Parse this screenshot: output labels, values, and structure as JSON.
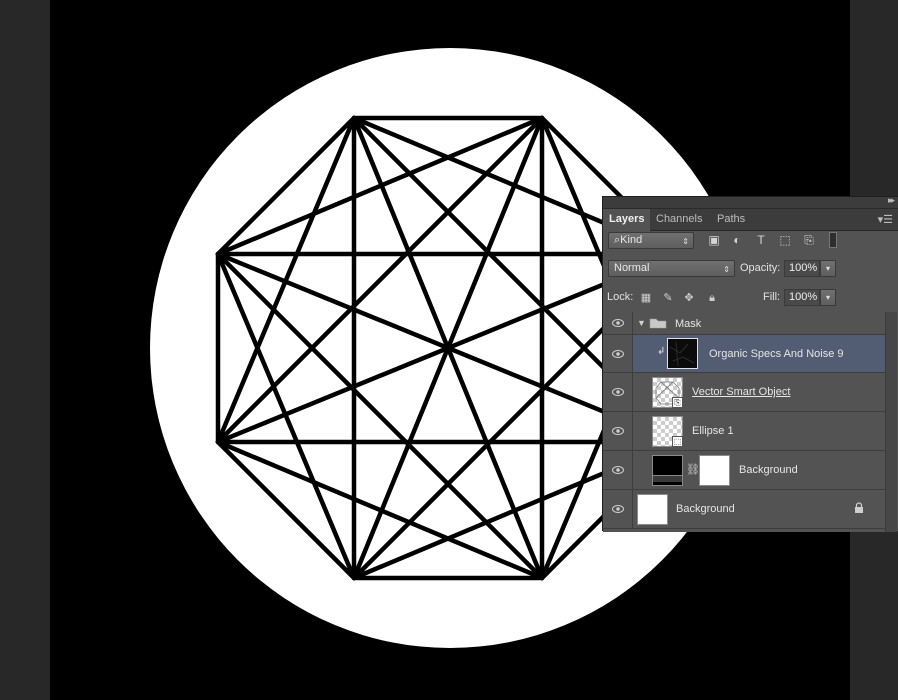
{
  "panel": {
    "tabs": [
      {
        "label": "Layers",
        "active": true
      },
      {
        "label": "Channels",
        "active": false
      },
      {
        "label": "Paths",
        "active": false
      }
    ],
    "filter": {
      "kind_label": "Kind",
      "icons": [
        "image-filter-icon",
        "adjustment-filter-icon",
        "type-filter-icon",
        "shape-filter-icon",
        "smart-object-filter-icon"
      ]
    },
    "blend_mode": "Normal",
    "opacity_label": "Opacity:",
    "opacity_value": "100%",
    "lock_label": "Lock:",
    "lock_icons": [
      "lock-transparent-icon",
      "lock-image-icon",
      "lock-position-icon",
      "lock-all-icon"
    ],
    "fill_label": "Fill:",
    "fill_value": "100%",
    "layers": [
      {
        "name": "Mask",
        "type": "group",
        "expanded": true,
        "visible": true
      },
      {
        "name": "Organic Specs And Noise 9",
        "type": "clipped",
        "selected": true,
        "visible": true
      },
      {
        "name": "Vector Smart Object",
        "type": "smart-object",
        "visible": true
      },
      {
        "name": "Ellipse 1",
        "type": "shape",
        "visible": true
      },
      {
        "name": "Background",
        "type": "masked",
        "visible": true
      },
      {
        "name": "Background",
        "type": "background",
        "locked": true,
        "visible": true
      }
    ]
  },
  "colors": {
    "canvas": "#000000",
    "panel": "#535353",
    "selected_layer": "#525c72",
    "app_background": "#282828"
  }
}
